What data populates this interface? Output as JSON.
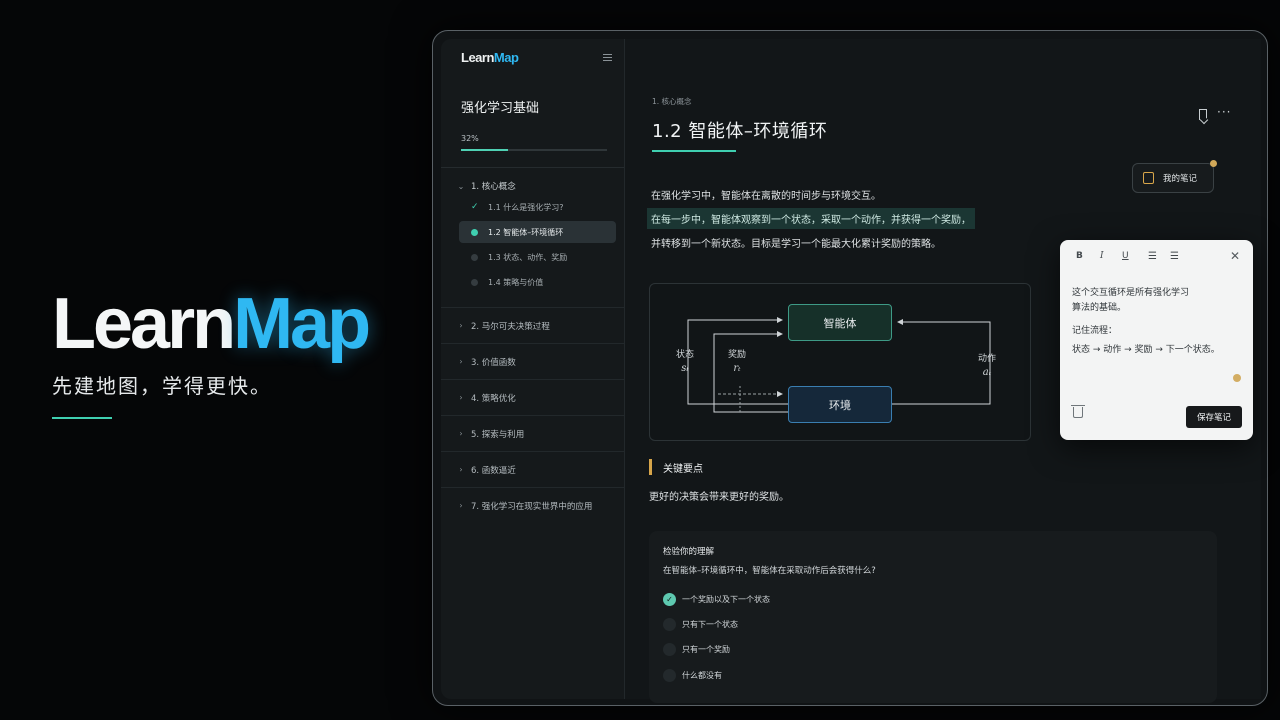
{
  "hero": {
    "logo_learn": "Learn",
    "logo_map": "Map",
    "tagline": "先建地图，学得更快。"
  },
  "sidebar": {
    "logo_learn": "Learn",
    "logo_map": "Map",
    "course_title": "强化学习基础",
    "progress_label": "32%",
    "progress_value": 0.32,
    "open_chapter": {
      "label": "1. 核心概念",
      "subs": [
        {
          "label": "1.1 什么是强化学习?",
          "state": "done"
        },
        {
          "label": "1.2 智能体–环境循环",
          "state": "active"
        },
        {
          "label": "1.3 状态、动作、奖励",
          "state": "todo"
        },
        {
          "label": "1.4 策略与价值",
          "state": "todo"
        }
      ]
    },
    "chapters": [
      "2. 马尔可夫决策过程",
      "3. 价值函数",
      "4. 策略优化",
      "5. 探索与利用",
      "6. 函数逼近",
      "7. 强化学习在现实世界中的应用"
    ]
  },
  "main": {
    "breadcrumb": "1. 核心概念",
    "title": "1.2  智能体–环境循环",
    "notes_button": "我的笔记",
    "para1": "在强化学习中，智能体在离散的时间步与环境交互。",
    "para2": "在每一步中，智能体观察到一个状态，采取一个动作，并获得一个奖励，",
    "para3": "并转移到一个新状态。目标是学习一个能最大化累计奖励的策略。",
    "diagram": {
      "agent": "智能体",
      "env": "环境",
      "state_label": "状态",
      "state_sym": "sₜ",
      "reward_label": "奖励",
      "reward_sym": "rₜ",
      "action_label": "动作",
      "action_sym": "aₜ"
    },
    "key_points_title": "关键要点",
    "key_points_text": "更好的决策会带来更好的奖励。",
    "quiz": {
      "title": "检验你的理解",
      "question": "在智能体–环境循环中，智能体在采取动作后会获得什么?",
      "options": [
        "一个奖励以及下一个状态",
        "只有下一个状态",
        "只有一个奖励",
        "什么都没有"
      ],
      "selected": 0
    }
  },
  "notes_panel": {
    "toolbar": {
      "bold": "B",
      "italic": "I",
      "underline": "U"
    },
    "line1": "这个交互循环是所有强化学习",
    "line2": "算法的基础。",
    "line3": "记住流程：",
    "line4": "状态 → 动作 → 奖励 → 下一个状态。",
    "save_button": "保存笔记"
  },
  "colors": {
    "accent_teal": "#3fcfb0",
    "brand_blue": "#2fb8f2",
    "highlight_gold": "#d6a54a"
  }
}
